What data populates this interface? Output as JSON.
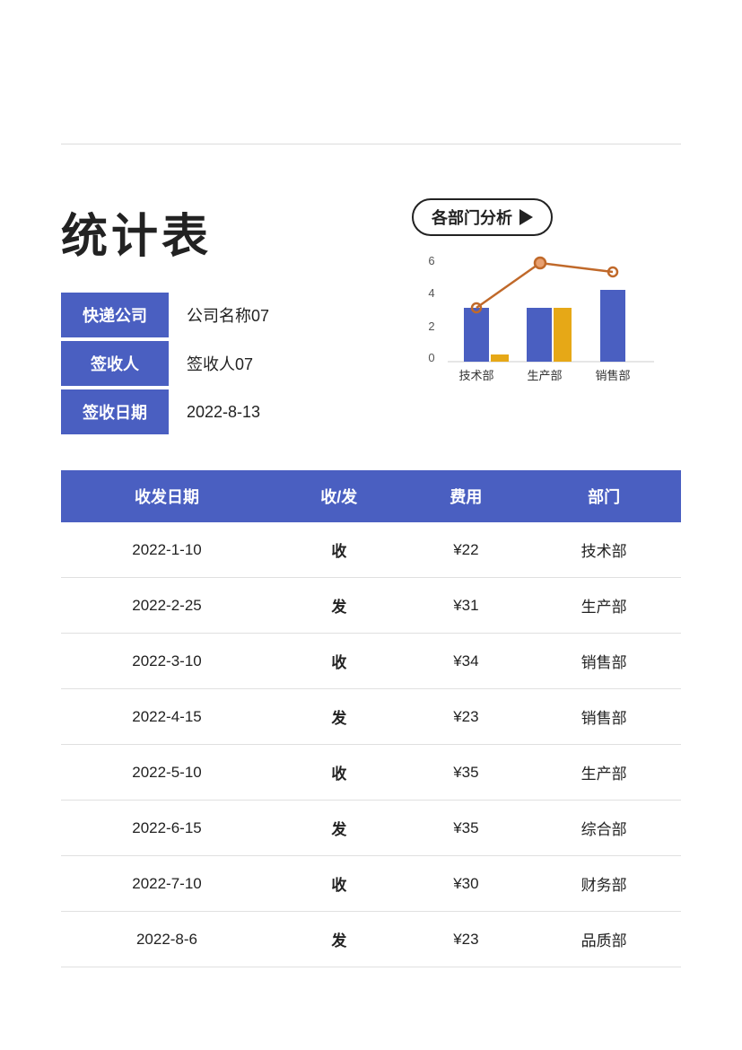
{
  "page": {
    "title": "统计表",
    "divider": true
  },
  "dept_button": {
    "label": "各部门分析"
  },
  "info": {
    "fields": [
      {
        "label": "快递公司",
        "value": "公司名称07"
      },
      {
        "label": "签收人",
        "value": "签收人07"
      },
      {
        "label": "签收日期",
        "value": "2022-8-13"
      }
    ]
  },
  "chart": {
    "y_labels": [
      "6",
      "4",
      "2",
      "0"
    ],
    "x_labels": [
      "技术部",
      "生产部",
      "销售部"
    ],
    "bars": [
      {
        "dept": "技术部",
        "blue": 3,
        "gold": 0
      },
      {
        "dept": "生产部",
        "blue": 3,
        "gold": 3
      },
      {
        "dept": "销售部",
        "blue": 4,
        "gold": 0
      }
    ],
    "line_points": [
      {
        "x": 0,
        "y": 3
      },
      {
        "x": 1,
        "y": 5.5
      },
      {
        "x": 2,
        "y": 5
      }
    ]
  },
  "table": {
    "headers": [
      "收发日期",
      "收/发",
      "费用",
      "部门"
    ],
    "rows": [
      {
        "date": "2022-1-10",
        "type": "收",
        "type_class": "receive",
        "cost": "¥22",
        "dept": "技术部"
      },
      {
        "date": "2022-2-25",
        "type": "发",
        "type_class": "send",
        "cost": "¥31",
        "dept": "生产部"
      },
      {
        "date": "2022-3-10",
        "type": "收",
        "type_class": "receive",
        "cost": "¥34",
        "dept": "销售部"
      },
      {
        "date": "2022-4-15",
        "type": "发",
        "type_class": "send",
        "cost": "¥23",
        "dept": "销售部"
      },
      {
        "date": "2022-5-10",
        "type": "收",
        "type_class": "receive",
        "cost": "¥35",
        "dept": "生产部"
      },
      {
        "date": "2022-6-15",
        "type": "发",
        "type_class": "send",
        "cost": "¥35",
        "dept": "综合部"
      },
      {
        "date": "2022-7-10",
        "type": "收",
        "type_class": "receive",
        "cost": "¥30",
        "dept": "财务部"
      },
      {
        "date": "2022-8-6",
        "type": "发",
        "type_class": "send",
        "cost": "¥23",
        "dept": "品质部"
      }
    ]
  },
  "colors": {
    "header_bg": "#4a5fc1",
    "receive": "#4a5fc1",
    "send": "#e6a817",
    "bar_blue": "#4a5fc1",
    "bar_gold": "#e6a817",
    "line": "#c0692a"
  }
}
